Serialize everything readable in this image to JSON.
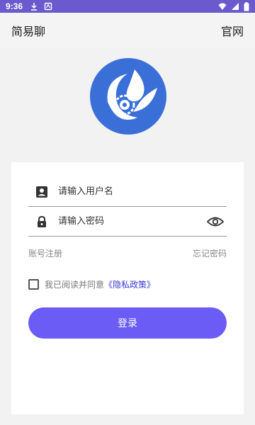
{
  "status_bar": {
    "time": "9:36",
    "icons": [
      "download-icon",
      "app-notification-icon",
      "wifi-icon",
      "signal-icon",
      "battery-icon"
    ]
  },
  "header": {
    "title": "简易聊",
    "official_site": "官网"
  },
  "form": {
    "username_placeholder": "请输入用户名",
    "password_placeholder": "请输入密码",
    "register": "账号注册",
    "forgot_password": "忘记密码",
    "agree_text": "我已阅读并同意",
    "policy_link": "《隐私政策》",
    "login_button": "登录"
  },
  "colors": {
    "status_bar": "#6a5acd",
    "accent": "#6a5cf5",
    "logo_blue": "#3a6fd8",
    "link_blue": "#3b39d8"
  }
}
